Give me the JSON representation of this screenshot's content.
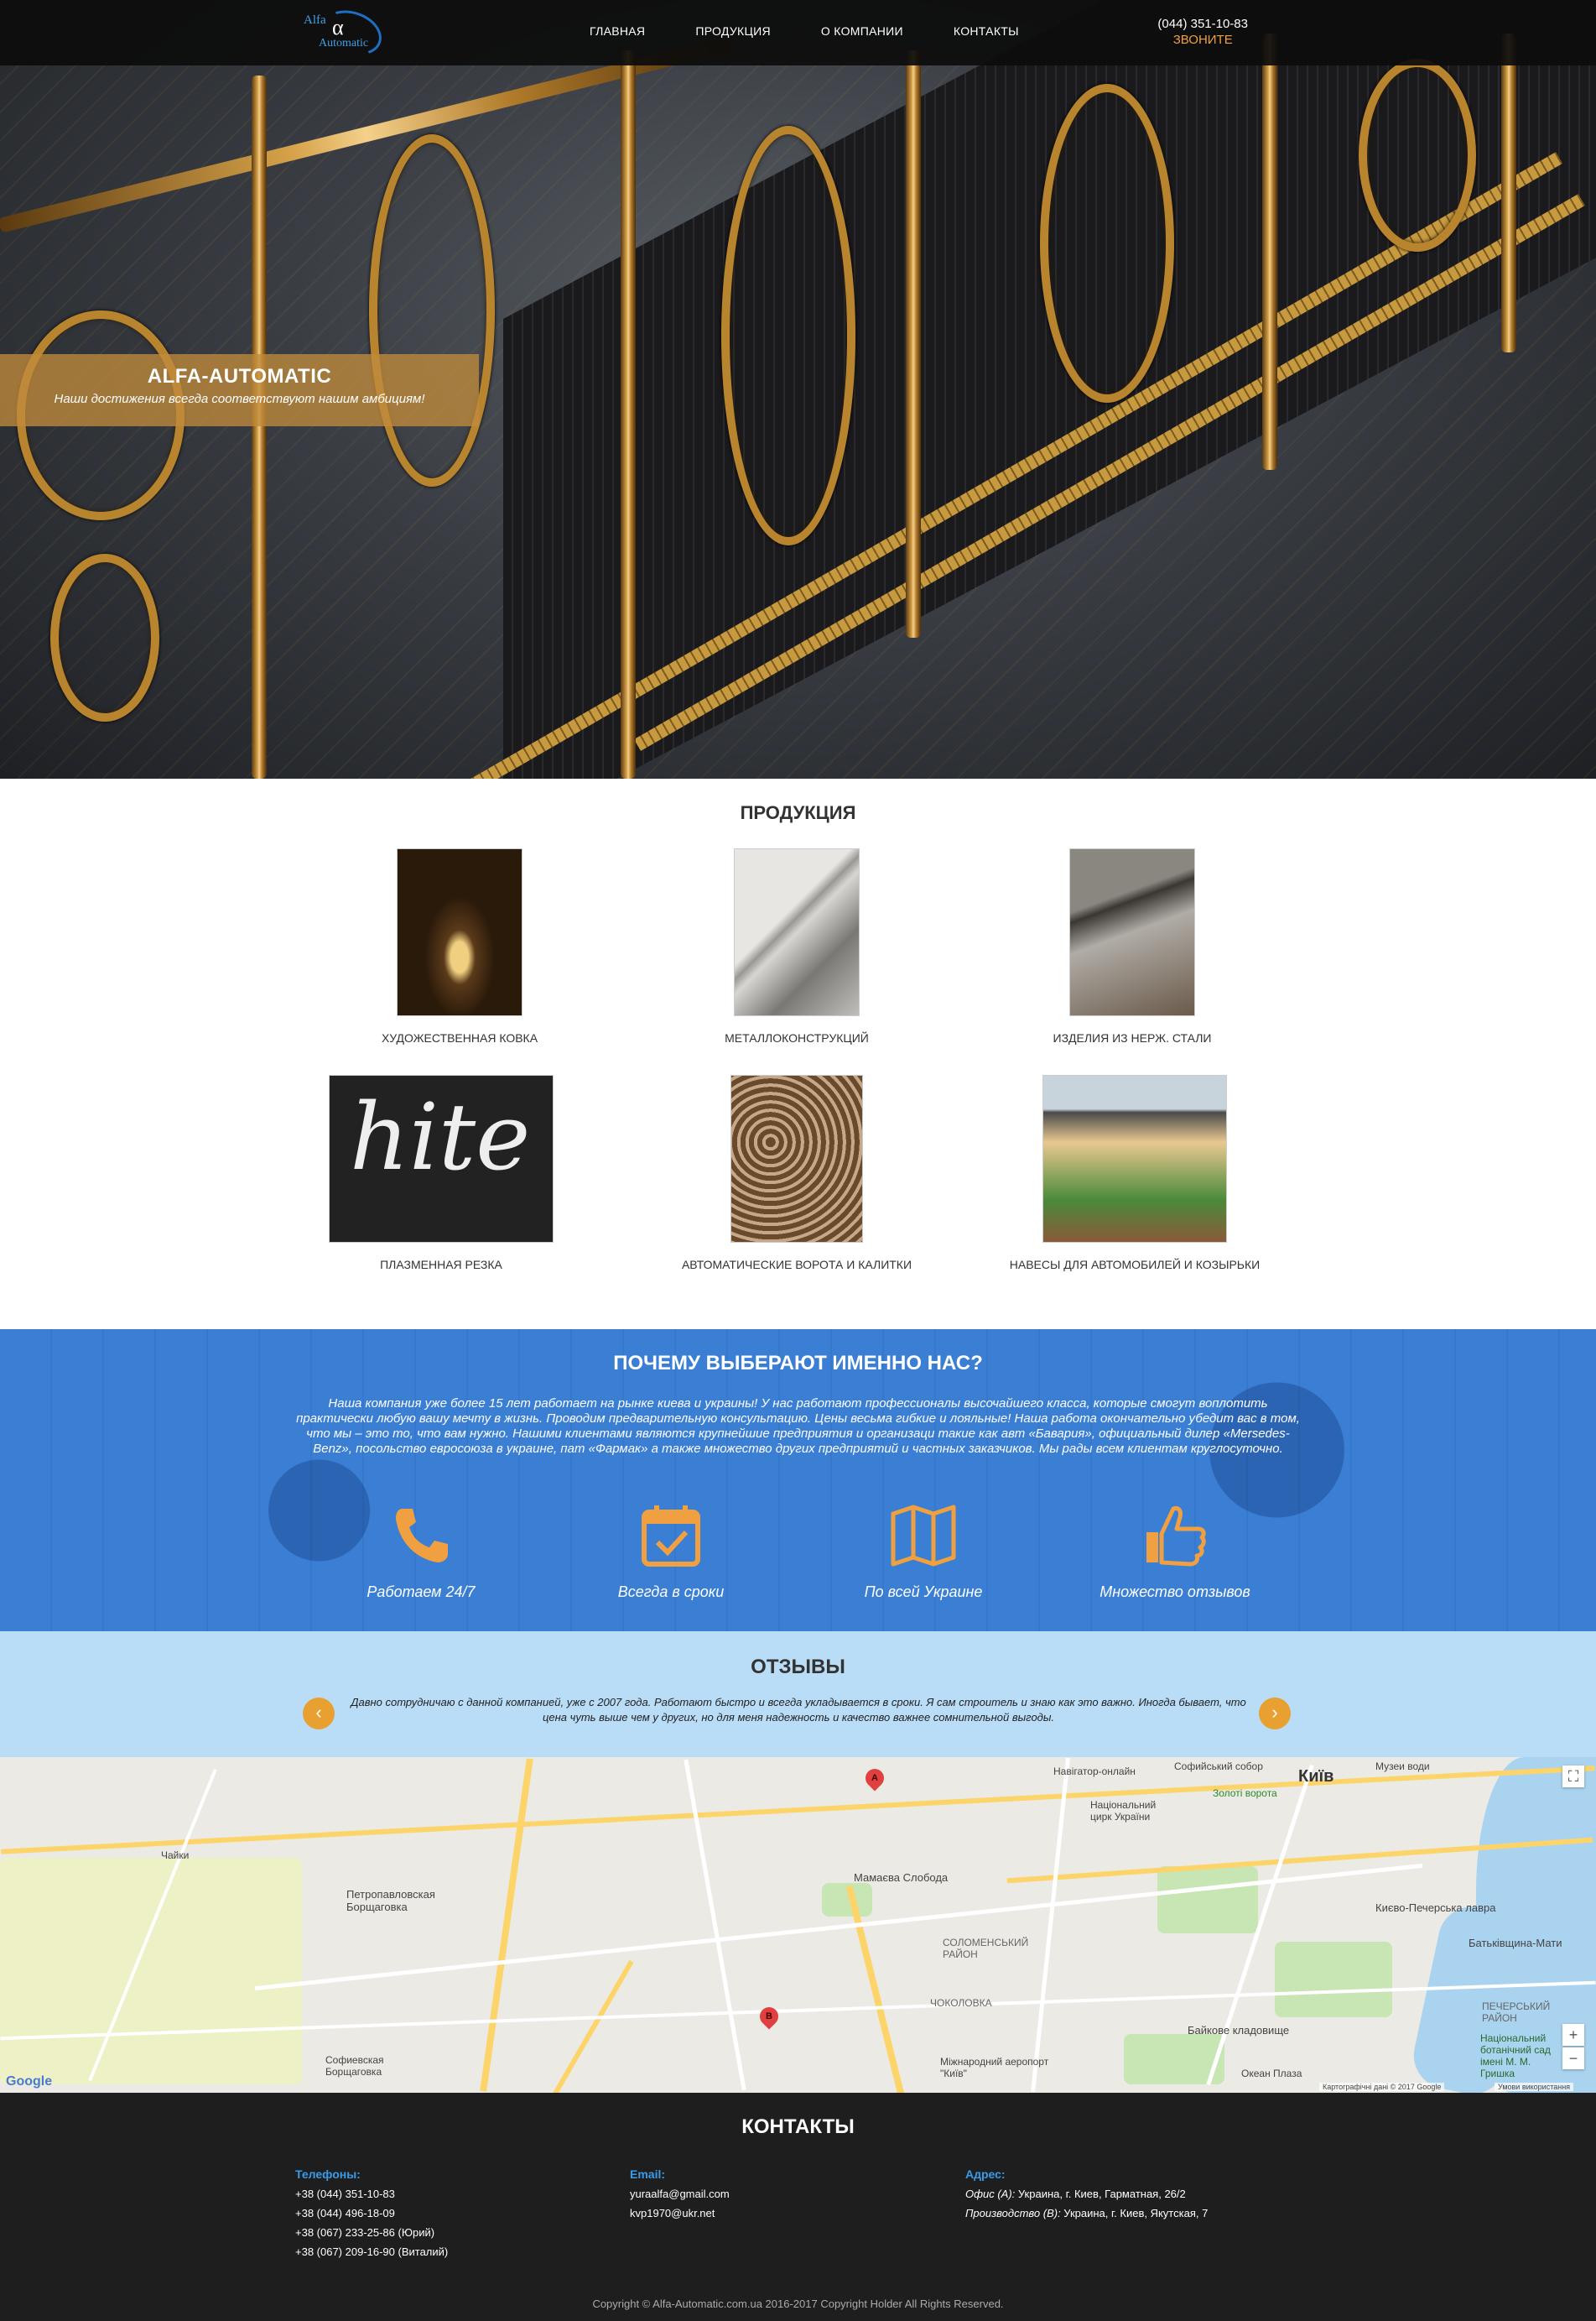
{
  "header": {
    "logo": {
      "part1": "Alfa",
      "part2": "α",
      "part3": "Automatic"
    },
    "nav": [
      "ГЛАВНАЯ",
      "ПРОДУКЦИЯ",
      "О КОМПАНИИ",
      "КОНТАКТЫ"
    ],
    "phone": "(044) 351-10-83",
    "call_label": "ЗВОНИТЕ"
  },
  "hero": {
    "title": "ALFA-AUTOMATIC",
    "subtitle": "Наши достижения всегда соответствуют нашим амбициям!"
  },
  "products": {
    "title": "ПРОДУКЦИЯ",
    "items": [
      {
        "label": "ХУДОЖЕСТВЕННАЯ КОВКА"
      },
      {
        "label": "МЕТАЛЛОКОНСТРУКЦИЙ"
      },
      {
        "label": "ИЗДЕЛИЯ ИЗ НЕРЖ. СТАЛИ"
      },
      {
        "label": "ПЛАЗМЕННАЯ РЕЗКА",
        "image_text": "hite"
      },
      {
        "label": "АВТОМАТИЧЕСКИЕ ВОРОТА И КАЛИТКИ"
      },
      {
        "label": "НАВЕСЫ ДЛЯ АВТОМОБИЛЕЙ И КОЗЫРЬКИ"
      }
    ]
  },
  "why": {
    "title": "ПОЧЕМУ ВЫБЕРАЮТ ИМЕННО НАС?",
    "text": "Наша компания уже более 15 лет работает на рынке киева и украины! У нас работают профессионалы высочайшего класса, которые смогут воплотить практически любую вашу мечту в жизнь. Проводим предварительную консультацию. Цены весьма гибкие и лояльные! Наша работа окончательно убедит вас в том, что мы – это то, что вам нужно. Нашими клиентами являются крупнейшие предприятия и организаци такие как авт «Бавария», официальный дилер «Mersedes-Benz», посольство евросоюза в украине, пат «Фармак» а также множество других предприятий и частных заказчиков. Мы рады всем клиентам круглосуточно.",
    "features": [
      {
        "label": "Работаем 24/7",
        "icon": "phone-icon"
      },
      {
        "label": "Всегда в сроки",
        "icon": "calendar-check-icon"
      },
      {
        "label": "По всей Украине",
        "icon": "map-icon"
      },
      {
        "label": "Множество отзывов",
        "icon": "thumbs-up-icon"
      }
    ]
  },
  "reviews": {
    "title": "ОТЗЫВЫ",
    "text": "Давно сотрудничаю с данной компанией, уже с 2007 года. Работают быстро и всегда укладывается в сроки. Я сам строитель и знаю как это важно. Иногда бывает, что цена чуть выше чем у других, но для меня надежность и качество важнее сомнительной выгоды.",
    "prev": "‹",
    "next": "›"
  },
  "map": {
    "labels": [
      "Київ",
      "Навігатор-онлайн",
      "Софийський собор",
      "Музеи води",
      "Національний цирк України",
      "Золоті ворота",
      "Мамаєва Слобода",
      "Петропавловская Борщаговка",
      "Чайки",
      "СОЛОМЕНСЬКИЙ РАЙОН",
      "ЧОКОЛОВКА",
      "Байкове кладовище",
      "Києво-Печерська лавра",
      "Батьківщина-Мати",
      "Софиевская Борщаговка",
      "Міжнародний аеропорт \"Київ\"",
      "ПЕЧЕРСЬКИЙ РАЙОН",
      "Національний ботанічний сад імені М. М. Гришка",
      "Океан Плаза"
    ],
    "pin_a": "A",
    "pin_b": "B",
    "zoom_in": "+",
    "zoom_out": "−",
    "fullscreen": "⛶",
    "google": "Google",
    "attribution": "Картографічні дані © 2017 Google",
    "terms": "Умови використання"
  },
  "footer": {
    "title": "КОНТАКТЫ",
    "phones_title": "Телефоны:",
    "phones": [
      "+38 (044) 351-10-83",
      "+38 (044) 496-18-09",
      "+38 (067) 233-25-86 (Юрий)",
      "+38 (067) 209-16-90 (Виталий)"
    ],
    "email_title": "Email:",
    "emails": [
      "yuraalfa@gmail.com",
      "kvp1970@ukr.net"
    ],
    "address_title": "Адрес:",
    "address_a_label": "Офис (А):",
    "address_a": " Украина, г. Киев, Гарматная, 26/2",
    "address_b_label": "Производство (В):",
    "address_b": " Украина, г. Киев, Якутская, 7",
    "copyright": "Copyright © Alfa-Automatic.com.ua 2016-2017 Copyright Holder All Rights Reserved."
  },
  "colors": {
    "accent": "#f0a040",
    "blue": "#3a7fd4",
    "light_blue": "#b9dcf7",
    "footer": "#1e1e1e",
    "link_blue": "#3a9be8"
  }
}
